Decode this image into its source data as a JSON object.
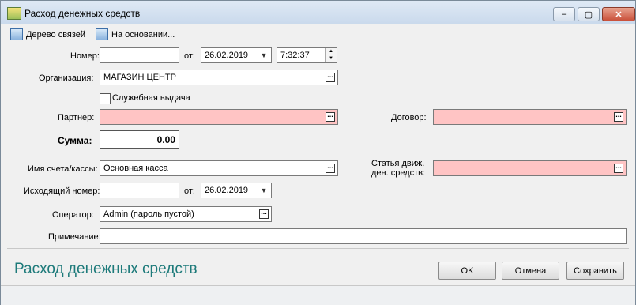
{
  "window": {
    "title": "Расход денежных средств"
  },
  "window_controls": {
    "minimize": "–",
    "maximize": "▢",
    "close": "✕"
  },
  "toolbar": {
    "relations_tree": "Дерево связей",
    "based_on": "На основании..."
  },
  "form": {
    "number_label": "Номер:",
    "number_value": "",
    "from_label": "от:",
    "date_value": "26.02.2019",
    "time_value": "7:32:37",
    "org_label": "Организация:",
    "org_value": "МАГАЗИН ЦЕНТР",
    "service_issue_label": "Служебная выдача",
    "partner_label": "Партнер:",
    "partner_value": "",
    "contract_label": "Договор:",
    "contract_value": "",
    "sum_label": "Сумма:",
    "sum_value": "0.00",
    "account_label": "Имя счета/кассы:",
    "account_value": "Основная касса",
    "article_label_1": "Статья движ.",
    "article_label_2": "ден. средств:",
    "article_value": "",
    "outgoing_label": "Исходящий номер:",
    "outgoing_value": "",
    "outgoing_from_label": "от:",
    "outgoing_date": "26.02.2019",
    "operator_label": "Оператор:",
    "operator_value": "Admin (пароль пустой)",
    "note_label": "Примечание:",
    "note_value": ""
  },
  "footer": {
    "title": "Расход денежных средств",
    "ok": "OK",
    "cancel": "Отмена",
    "save": "Сохранить"
  }
}
